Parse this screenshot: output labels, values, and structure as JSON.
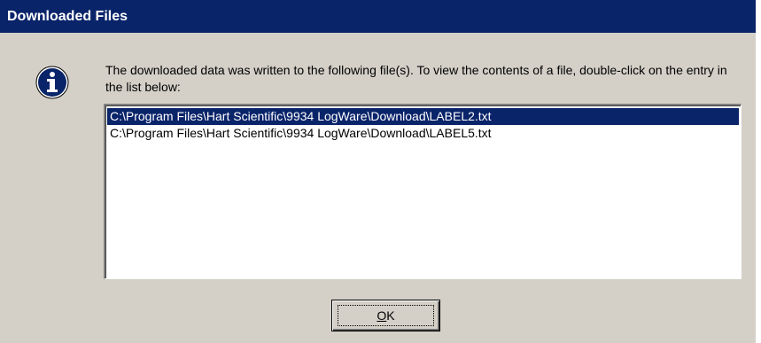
{
  "window": {
    "title": "Downloaded Files"
  },
  "icon": {
    "name": "info-icon",
    "glyph": "i",
    "color": "#0a246a"
  },
  "message": "The downloaded data was written to the following file(s). To view the contents of a file, double-click on the entry in the list below:",
  "file_list": {
    "items": [
      {
        "path": "C:\\Program Files\\Hart Scientific\\9934 LogWare\\Download\\LABEL2.txt",
        "selected": true
      },
      {
        "path": "C:\\Program Files\\Hart Scientific\\9934 LogWare\\Download\\LABEL5.txt",
        "selected": false
      }
    ]
  },
  "ok_button": {
    "mnemonic": "O",
    "rest": "K"
  },
  "colors": {
    "title_bar": "#0a246a",
    "window_face": "#d4d0c8",
    "selection": "#0a246a"
  }
}
